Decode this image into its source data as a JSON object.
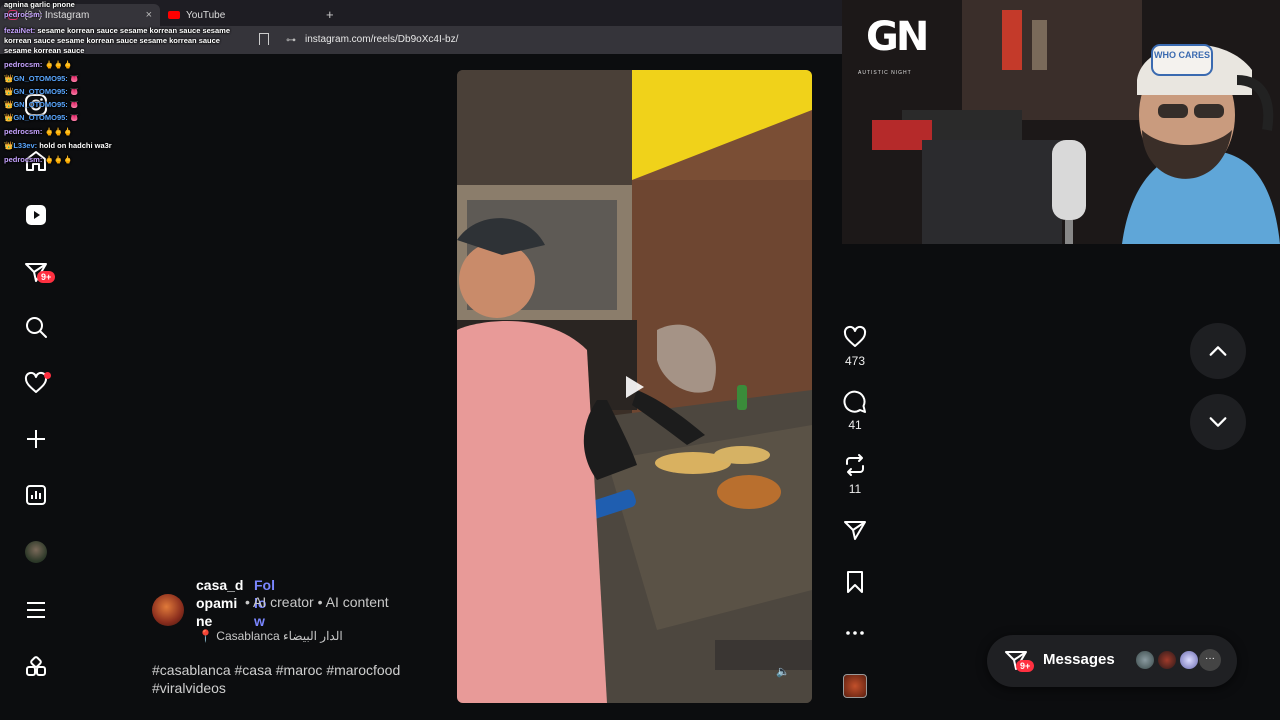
{
  "browser": {
    "tabs": [
      {
        "label": "(9+) Instagram",
        "active": true
      },
      {
        "label": "YouTube",
        "active": false
      }
    ],
    "new_tab": "+",
    "close": "×",
    "url": "instagram.com/reels/Db9oXc4I-bz/"
  },
  "chat": [
    {
      "user": "",
      "text": "agnina garlic pnone"
    },
    {
      "user": "pedrocsm:",
      "text": ""
    },
    {
      "user": "fezaiNet:",
      "text": "sesame korrean sauce sesame korrean sauce sesame korrean sauce sesame korrean sauce sesame korrean sauce sesame korrean sauce"
    },
    {
      "user": "pedrocsm:",
      "text": "🖕🖕🖕"
    },
    {
      "user": "GN_OTOMO95:",
      "text": "👅"
    },
    {
      "user": "GN_OTOMO95:",
      "text": "👅"
    },
    {
      "user": "GN_OTOMO95:",
      "text": "👅"
    },
    {
      "user": "GN_OTOMO95:",
      "text": "👅"
    },
    {
      "user": "pedrocsm:",
      "text": "🖕🖕🖕"
    },
    {
      "user": "L33ev:",
      "text": "hold on hadchi wa3r"
    },
    {
      "user": "pedrocsm:",
      "text": "🖕🖕🖕"
    }
  ],
  "sidebar": {
    "badges": {
      "messages": "9+"
    },
    "items": [
      "instagram-logo",
      "home",
      "reels",
      "messages",
      "search",
      "notifications",
      "create",
      "dashboard",
      "profile",
      "more",
      "also-from-meta"
    ]
  },
  "reel": {
    "author": "casa_dopamine",
    "author_lines": [
      "casa_d",
      "opami",
      "ne"
    ],
    "follow_lines": [
      "Fol",
      "lo",
      "w"
    ],
    "meta": "• AI creator • AI content",
    "location": "Casablanca الدار البيضاء",
    "caption": "#casablanca #casa #maroc #marocfood #viralvideos",
    "likes": "473",
    "comments": "41",
    "reposts": "11"
  },
  "messages": {
    "label": "Messages",
    "badge": "9+",
    "more": "···"
  },
  "overlay": {
    "logo": "GN",
    "logo_sub": "AUTISTIC NIGHT",
    "cap_text": "WHO CARES"
  },
  "colors": {
    "accent": "#7a86ff",
    "notification": "#ff3040",
    "background": "#0c0d0f"
  }
}
